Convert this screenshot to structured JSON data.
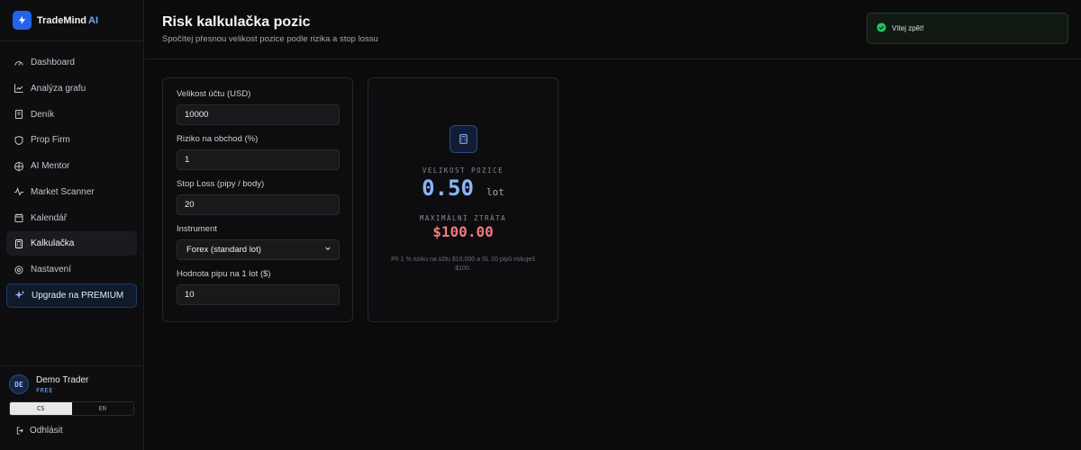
{
  "brand": {
    "name": "TradeMind",
    "ai": "AI",
    "accent": "#2563eb"
  },
  "sidebar": {
    "items": [
      {
        "label": "Dashboard",
        "icon": "gauge-icon"
      },
      {
        "label": "Analýza grafu",
        "icon": "chart-line-icon"
      },
      {
        "label": "Deník",
        "icon": "book-icon"
      },
      {
        "label": "Prop Firm",
        "icon": "shield-icon"
      },
      {
        "label": "AI Mentor",
        "icon": "brain-icon"
      },
      {
        "label": "Market Scanner",
        "icon": "activity-icon"
      },
      {
        "label": "Kalendář",
        "icon": "calendar-icon"
      },
      {
        "label": "Kalkulačka",
        "icon": "calculator-icon",
        "active": true
      },
      {
        "label": "Nastavení",
        "icon": "gear-icon"
      },
      {
        "label": "Upgrade na PREMIUM",
        "icon": "sparkles-icon",
        "premium": true
      }
    ],
    "user": {
      "initials": "DE",
      "name": "Demo Trader",
      "plan": "FREE"
    },
    "languages": [
      "CS",
      "EN"
    ],
    "selected_language": "CS",
    "logout": "Odhlásit"
  },
  "header": {
    "title": "Risk kalkulačka pozic",
    "subtitle": "Spočítej přesnou velikost pozice podle rizika a stop lossu"
  },
  "toast": {
    "text": "Vítej zpět!",
    "color": "#22c55e"
  },
  "form": {
    "account_size": {
      "label": "Velikost účtu (USD)",
      "value": "10000"
    },
    "risk": {
      "label": "Riziko na obchod (%)",
      "value": "1"
    },
    "stop_loss": {
      "label": "Stop Loss (pipy / body)",
      "value": "20"
    },
    "instrument": {
      "label": "Instrument",
      "value": "Forex (standard lot)"
    },
    "pip_value": {
      "label": "Hodnota pipu na 1 lot ($)",
      "value": "10"
    }
  },
  "result": {
    "size_label": "VELIKOST POZICE",
    "size_value": "0.50",
    "size_unit": "lot",
    "loss_label": "MAXIMÁLNÍ ZTRÁTA",
    "loss_value": "$100.00",
    "note": "Při 1 % riziku na účtu $10,000 a SL 20 pipů riskuješ $100."
  }
}
